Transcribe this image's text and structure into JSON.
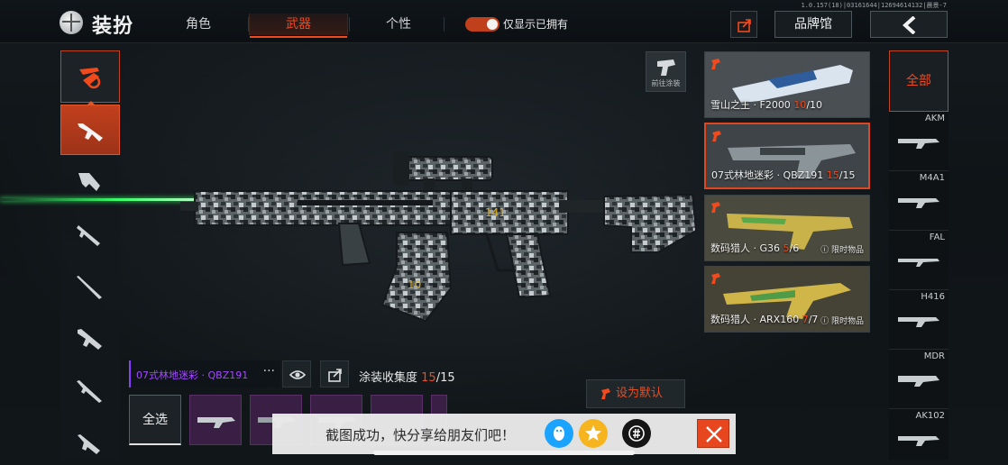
{
  "status": {
    "version": "1.0.157(18)|03161644|12694614132|晨景-7"
  },
  "header": {
    "title": "装扮",
    "tabs": [
      {
        "label": "角色",
        "active": false
      },
      {
        "label": "武器",
        "active": true
      },
      {
        "label": "个性",
        "active": false
      }
    ],
    "toggle": {
      "label": "仅显示已拥有",
      "on": true
    },
    "brand_label": "品牌馆"
  },
  "stage": {
    "goto_paint_label": "前往涂装",
    "weapon_stamp": "141",
    "current_skin_name": "07式林地迷彩 · QBZ191",
    "more_glyph": "···",
    "collection_label": "涂装收集度",
    "collection_current": "15",
    "collection_total": "/15",
    "select_all_label": "全选",
    "set_default_label": "设为默认"
  },
  "skins": [
    {
      "label": "雪山之王 · F2000",
      "owned": "10",
      "total": "/10",
      "limited": ""
    },
    {
      "label": "07式林地迷彩 · QBZ191",
      "owned": "15",
      "total": "/15",
      "limited": "",
      "selected": true
    },
    {
      "label": "数码猎人 · G36",
      "owned": "5",
      "total": "/6",
      "limited": "限时物品"
    },
    {
      "label": "数码猎人 · ARX160",
      "owned": "7",
      "total": "/7",
      "limited": "限时物品"
    }
  ],
  "weapon_filter": {
    "all_label": "全部",
    "items": [
      "AKM",
      "M4A1",
      "FAL",
      "H416",
      "MDR",
      "AK102"
    ]
  },
  "toast": {
    "message": "截图成功，快分享给朋友们吧！"
  },
  "colors": {
    "accent": "#f04a1d",
    "purple": "#a24bff"
  }
}
